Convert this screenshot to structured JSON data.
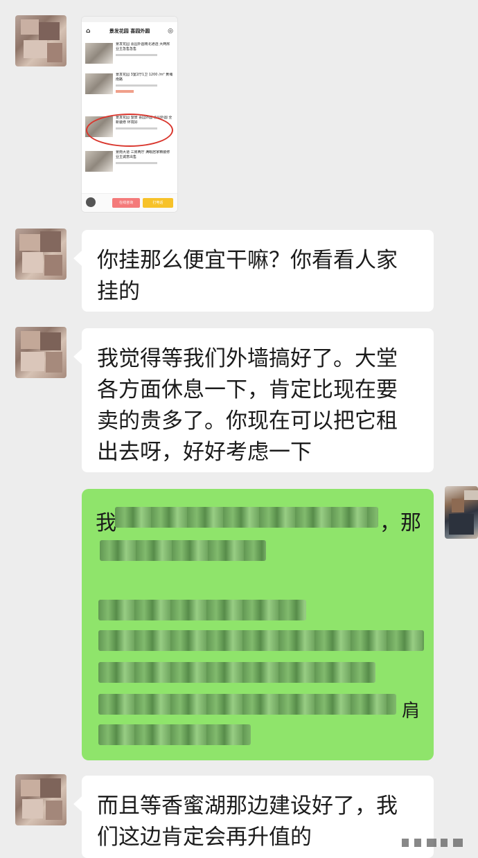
{
  "messages": {
    "image_message": {
      "listing_page_title": "景发花园 喜园外圆",
      "home_icon": "⌂",
      "target_icon": "◎",
      "listings": [
        {
          "title": "景发花园 喜园外圆南北通透 大两房 业主急售急售"
        },
        {
          "title": "景发花园 3室2厅1卫 1200 /m² 黄埔南路"
        },
        {
          "title": "景发花园 望景 喜园外圆 喜园外圆 全新装修 环境好"
        },
        {
          "title": "景南大道 三房两厅 满眼居家精装修 业主诚意出售"
        }
      ],
      "footer_button_1": "在线咨询",
      "footer_button_2": "打电话"
    },
    "text_1": "你挂那么便宜干嘛？你看看人家挂的",
    "text_2": "我觉得等我们外墙搞好了。大堂各方面休息一下，肯定比现在要卖的贵多了。你现在可以把它租出去呀，好好考虑一下",
    "reply_visible_fragments": {
      "start": "我",
      "end1": "，那",
      "end2": "肩"
    },
    "text_3": "而且等香蜜湖那边建设好了，我们这边肯定会再升值的"
  },
  "colors": {
    "chat_background": "#ededed",
    "incoming_bubble": "#ffffff",
    "outgoing_bubble": "#8fe46b",
    "highlight_circle": "#d9352c"
  }
}
